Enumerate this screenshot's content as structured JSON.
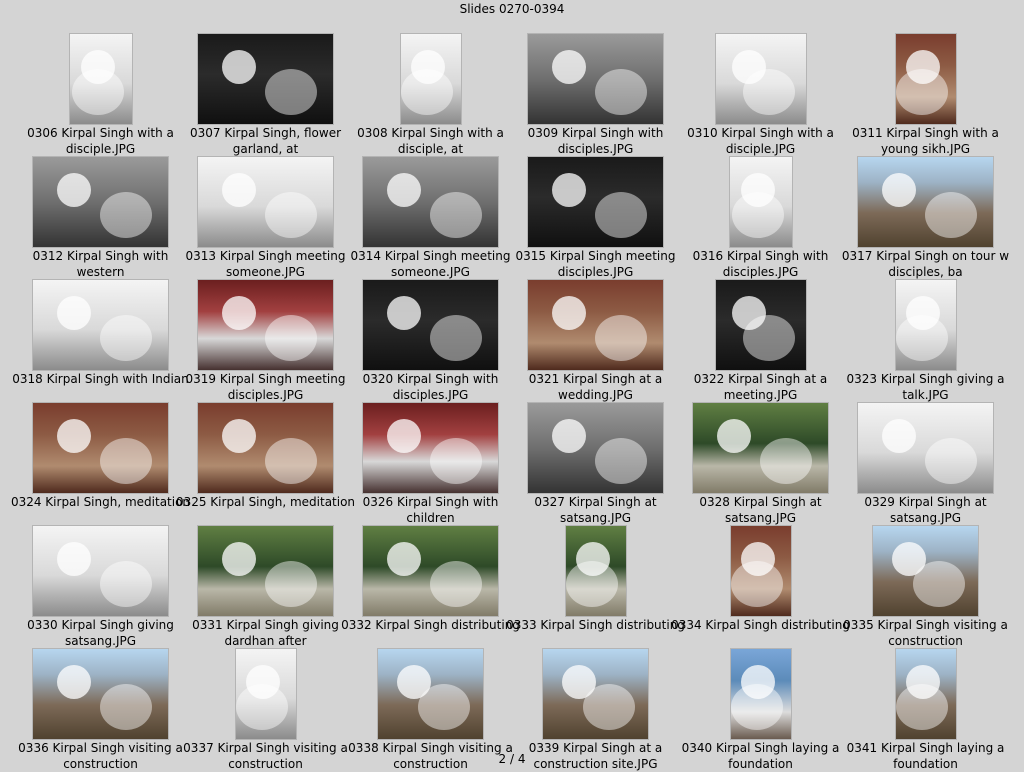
{
  "header": {
    "title": "Slides 0270-0394"
  },
  "pager": {
    "label": "2 / 4"
  },
  "slides": [
    {
      "caption": "0306  Kirpal Singh with a disciple.JPG"
    },
    {
      "caption": "0307  Kirpal Singh, flower garland, at"
    },
    {
      "caption": "0308  Kirpal Singh with a disciple, at"
    },
    {
      "caption": "0309  Kirpal Singh with disciples.JPG"
    },
    {
      "caption": "0310  Kirpal Singh with a disciple.JPG"
    },
    {
      "caption": "0311  Kirpal Singh with a young sikh.JPG"
    },
    {
      "caption": "0312  Kirpal Singh with western"
    },
    {
      "caption": "0313  Kirpal Singh meeting someone.JPG"
    },
    {
      "caption": "0314  Kirpal Singh meeting someone.JPG"
    },
    {
      "caption": "0315  Kirpal Singh meeting disciples.JPG"
    },
    {
      "caption": "0316  Kirpal Singh with disciples.JPG"
    },
    {
      "caption": "0317  Kirpal Singh on tour w disciples, ba"
    },
    {
      "caption": "0318  Kirpal Singh with Indian"
    },
    {
      "caption": "0319  Kirpal Singh meeting disciples.JPG"
    },
    {
      "caption": "0320  Kirpal Singh with disciples.JPG"
    },
    {
      "caption": "0321  Kirpal Singh at a wedding.JPG"
    },
    {
      "caption": "0322  Kirpal Singh at a meeting.JPG"
    },
    {
      "caption": "0323  Kirpal Singh giving a talk.JPG"
    },
    {
      "caption": "0324  Kirpal Singh, meditation"
    },
    {
      "caption": "0325  Kirpal Singh, meditation"
    },
    {
      "caption": "0326  Kirpal Singh with children"
    },
    {
      "caption": "0327  Kirpal Singh at satsang.JPG"
    },
    {
      "caption": "0328  Kirpal Singh at satsang.JPG"
    },
    {
      "caption": "0329  Kirpal Singh at satsang.JPG"
    },
    {
      "caption": "0330  Kirpal Singh giving satsang.JPG"
    },
    {
      "caption": "0331  Kirpal Singh giving dardhan after"
    },
    {
      "caption": "0332  Kirpal Singh distributing"
    },
    {
      "caption": "0333  Kirpal Singh distributing"
    },
    {
      "caption": "0334  Kirpal Singh distributing"
    },
    {
      "caption": "0335  Kirpal Singh visiting a construction"
    },
    {
      "caption": "0336  Kirpal Singh visiting a construction"
    },
    {
      "caption": "0337  Kirpal Singh visiting a construction"
    },
    {
      "caption": "0338  Kirpal Singh visiting a construction"
    },
    {
      "caption": "0339  Kirpal Singh at a construction site.JPG"
    },
    {
      "caption": "0340  Kirpal Singh laying a foundation"
    },
    {
      "caption": "0341  Kirpal Singh laying a foundation"
    }
  ]
}
